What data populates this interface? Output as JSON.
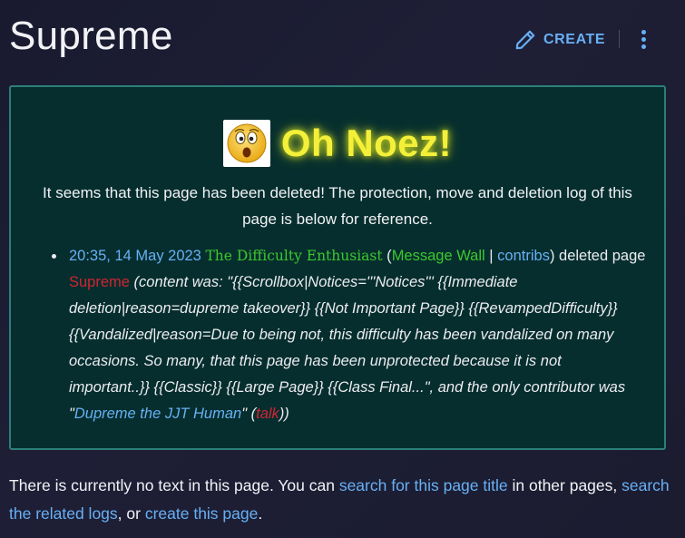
{
  "header": {
    "title": "Supreme",
    "create_label": "CREATE",
    "create_icon": "pencil-icon",
    "more_icon": "more-vertical-icon"
  },
  "notice": {
    "emoji": "surprised-face-emoji",
    "heading": "Oh Noez!",
    "description": "It seems that this page has been deleted! The protection, move and deletion log of this page is below for reference.",
    "log": {
      "timestamp": "20:35, 14 May 2023",
      "user": "The Difficulty Enthusiast",
      "paren_open": " (",
      "message_wall": "Message Wall",
      "separator": " | ",
      "contribs": "contribs",
      "deleted_text": ") deleted page ",
      "page": "Supreme",
      "content_prefix": " (content was: \"",
      "content": "{{Scrollbox|Notices='''Notices''' {{Immediate deletion|reason=dupreme takeover}} {{Not Important Page}} {{RevampedDifficulty}} {{Vandalized|reason=Due to being not, this difficulty has been vandalized on many occasions. So many, that this page has been unprotected because it is not important..}} {{Classic}} {{Large Page}} {{Class Final...",
      "contributor_prefix": "\", and the only contributor was \"",
      "contributor": "Dupreme the JJT Human",
      "contributor_suffix": "\" (",
      "talk": "talk",
      "end": "))"
    }
  },
  "footer": {
    "text1": "There is currently no text in this page. You can ",
    "link1": "search for this page title",
    "text2": " in other pages, ",
    "link2": "search the related logs",
    "text3": ", or ",
    "link3": "create this page",
    "text4": "."
  },
  "colors": {
    "background": "#1b1c30",
    "accent": "#68b0f4",
    "notice_bg": "#062e2e",
    "notice_border": "#2c7f78",
    "heading": "#f4f03a",
    "user_green": "#3cc92c",
    "red_link": "#d02432"
  }
}
